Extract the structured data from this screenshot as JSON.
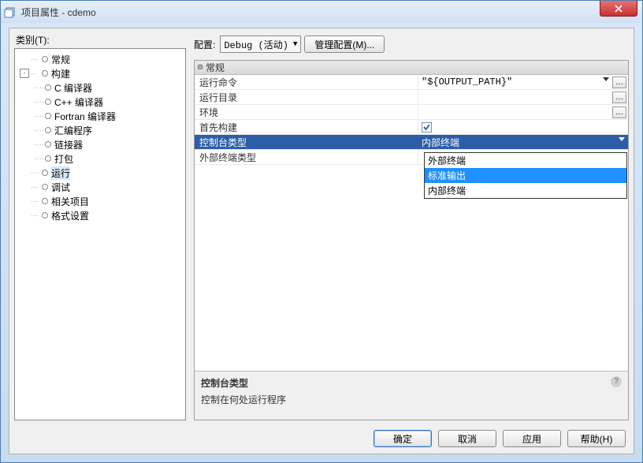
{
  "window": {
    "title": "项目属性 - cdemo"
  },
  "sidebar": {
    "label": "类别(T):",
    "items": [
      {
        "label": "常规"
      },
      {
        "label": "构建",
        "children": [
          {
            "label": "C 编译器"
          },
          {
            "label": "C++ 编译器"
          },
          {
            "label": "Fortran 编译器"
          },
          {
            "label": "汇编程序"
          },
          {
            "label": "链接器"
          },
          {
            "label": "打包"
          }
        ]
      },
      {
        "label": "运行",
        "selected": true
      },
      {
        "label": "调试"
      },
      {
        "label": "相关项目"
      },
      {
        "label": "格式设置"
      }
    ]
  },
  "config": {
    "label": "配置:",
    "value": "Debug (活动)",
    "manage_btn": "管理配置(M)..."
  },
  "props": {
    "section": "常规",
    "rows": [
      {
        "key": "运行命令",
        "val": "\"${OUTPUT_PATH}\"",
        "has_ellipsis": true,
        "has_caret": true
      },
      {
        "key": "运行目录",
        "val": "",
        "has_ellipsis": true
      },
      {
        "key": "环境",
        "val": "",
        "has_ellipsis": true
      },
      {
        "key": "首先构建",
        "val": "",
        "checkbox": true,
        "checked": true
      },
      {
        "key": "控制台类型",
        "val": "内部终端",
        "selected": true,
        "has_solo_caret": true
      },
      {
        "key": "外部终端类型",
        "val": ""
      }
    ]
  },
  "dropdown": {
    "options": [
      {
        "label": "外部终端"
      },
      {
        "label": "标准输出",
        "selected": true
      },
      {
        "label": "内部终端"
      }
    ]
  },
  "description": {
    "title": "控制台类型",
    "body": "控制在何处运行程序"
  },
  "buttons": {
    "ok": "确定",
    "cancel": "取消",
    "apply": "应用",
    "help": "帮助(H)"
  }
}
